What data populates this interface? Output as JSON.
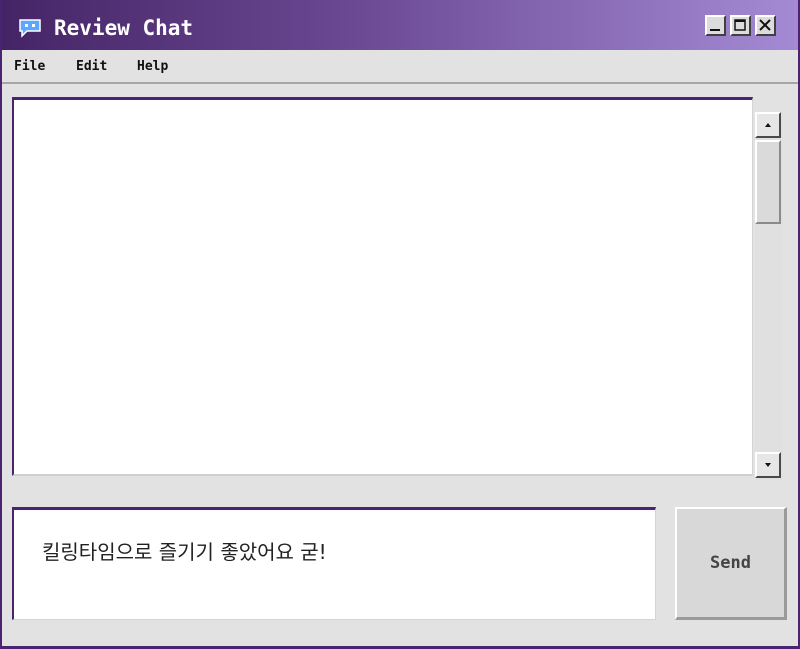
{
  "window": {
    "title": "Review Chat",
    "icon": "chat-bubble-icon",
    "controls": [
      "minimize-icon",
      "maximize-icon",
      "close-icon"
    ]
  },
  "menu": {
    "items": [
      {
        "label": "File"
      },
      {
        "label": "Edit"
      },
      {
        "label": "Help"
      }
    ]
  },
  "chat": {
    "messages": []
  },
  "input": {
    "value": "킬링타임으로 즐기기 좋았어요 굳!"
  },
  "send": {
    "label": "Send"
  },
  "colors": {
    "accent": "#4a2470",
    "titlebar_start": "#452466",
    "titlebar_end": "#a48ad4",
    "icon_blue": "#5aa8ff"
  }
}
